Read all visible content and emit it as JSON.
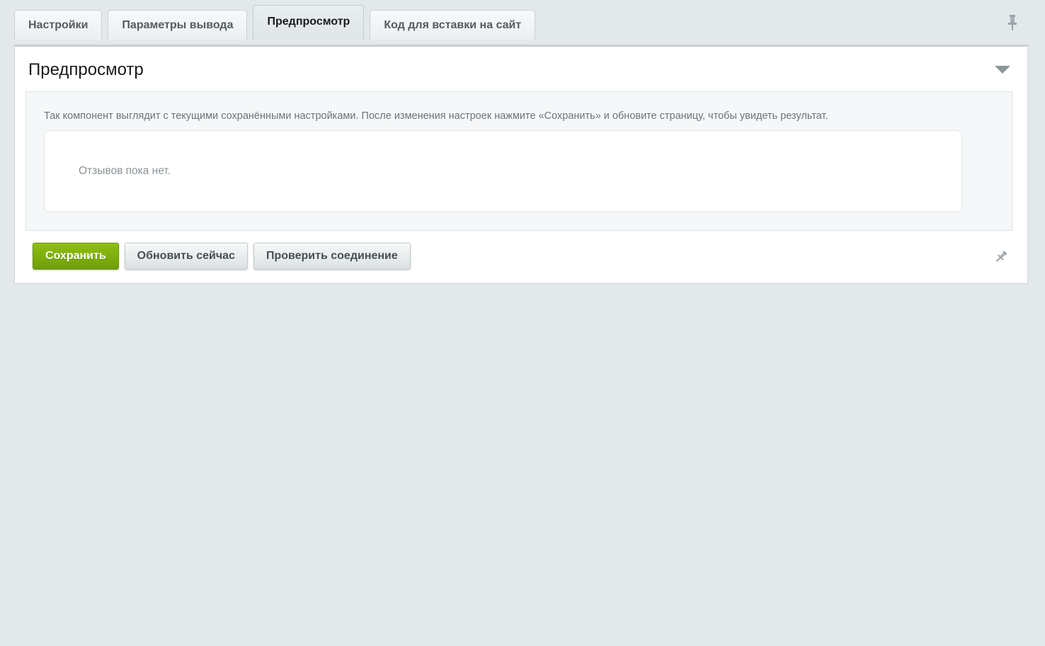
{
  "tabs": [
    {
      "label": "Настройки",
      "active": false
    },
    {
      "label": "Параметры вывода",
      "active": false
    },
    {
      "label": "Предпросмотр",
      "active": true
    },
    {
      "label": "Код для вставки на сайт",
      "active": false
    }
  ],
  "panel": {
    "title": "Предпросмотр",
    "note": "Так компонент выглядит с текущими сохранёнными настройками. После изменения настроек нажмите «Сохранить» и обновите страницу, чтобы увидеть результат.",
    "empty_text": "Отзывов пока нет."
  },
  "buttons": {
    "save": "Сохранить",
    "refresh": "Обновить сейчас",
    "check": "Проверить соединение"
  },
  "icons": {
    "top_pin": "pin-icon",
    "collapse": "chevron-down-icon",
    "bottom_pin": "pin-icon"
  },
  "colors": {
    "primary_button": "#7aab0c",
    "page_background": "#e3e9eb"
  }
}
